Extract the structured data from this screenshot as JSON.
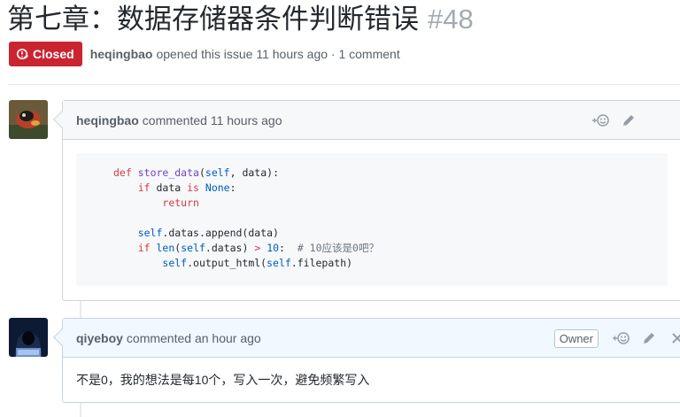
{
  "issue": {
    "title": "第七章：数据存储器条件判断错误",
    "number": "#48",
    "state": "Closed",
    "author": "heqingbao",
    "opened_text": "opened this issue 11 hours ago · 1 comment"
  },
  "comments": [
    {
      "author": "heqingbao",
      "time_text": "commented 11 hours ago",
      "code_lines": [
        "def store_data(self, data):",
        "    if data is None:",
        "        return",
        "",
        "    self.datas.append(data)",
        "    if len(self.datas) > 10:  # 10应该是0吧？",
        "        self.output_html(self.filepath)"
      ]
    },
    {
      "author": "qiyeboy",
      "time_text": "commented an hour ago",
      "badge": "Owner",
      "body": "不是0，我的想法是每10个，写入一次，避免频繁写入"
    }
  ],
  "icons": {
    "state": "issue-closed-icon",
    "reaction": "smiley-plus-icon",
    "edit": "pencil-icon",
    "delete": "x-icon"
  },
  "colors": {
    "closed": "#cb2431",
    "owner_header": "#f1f8ff",
    "header": "#f6f8fa"
  }
}
